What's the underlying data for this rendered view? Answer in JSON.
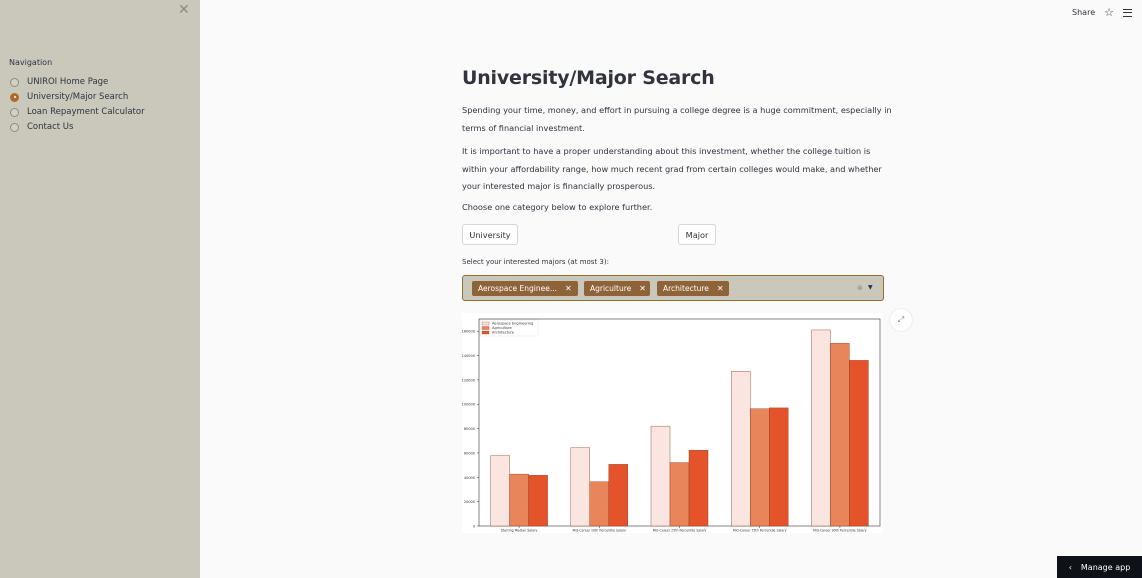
{
  "sidebar": {
    "close_icon": "close-icon",
    "nav_title": "Navigation",
    "items": [
      {
        "label": "UNIROI Home Page",
        "selected": false
      },
      {
        "label": "University/Major Search",
        "selected": true
      },
      {
        "label": "Loan Repayment Calculator",
        "selected": false
      },
      {
        "label": "Contact Us",
        "selected": false
      }
    ]
  },
  "topbar": {
    "share_label": "Share",
    "star_icon": "star-icon",
    "menu_icon": "hamburger-menu-icon"
  },
  "main": {
    "title": "University/Major Search",
    "para1": "Spending your time, money, and effort in pursuing a college degree is a huge commitment, especially in terms of financial investment.",
    "para2": "It is important to have a proper understanding about this investment, whether the college tuition is within your affordability range, how much recent grad from certain colleges would make, and whether your interested major is financially prosperous.",
    "para3": "Choose one category below to explore further.",
    "btn_university": "University",
    "btn_major": "Major",
    "multiselect_label": "Select your interested majors (at most 3):",
    "chips": [
      "Aerospace Enginee...",
      "Agriculture",
      "Architecture"
    ]
  },
  "manage_app_label": "Manage app",
  "colors": {
    "sidebar_bg": "#c9c8bb",
    "accent": "#8f633a",
    "s1": "#fbe5e1",
    "s2": "#e8855a",
    "s3": "#e5532a"
  },
  "chart_data": {
    "type": "bar",
    "categories": [
      "Starting Median Salary",
      "Mid-Career 10th Percentile Salary",
      "Mid-Career 25th Percentile Salary",
      "Mid-Career 75th Percentile Salary",
      "Mid-Career 90th Percentile Salary"
    ],
    "series": [
      {
        "name": "Aerospace Engineering",
        "color": "#fbe5e1",
        "values": [
          57700,
          64300,
          82000,
          127000,
          161000
        ]
      },
      {
        "name": "Agriculture",
        "color": "#e8855a",
        "values": [
          42600,
          36300,
          52100,
          96300,
          150000
        ]
      },
      {
        "name": "Architecture",
        "color": "#e5532a",
        "values": [
          41600,
          50600,
          62200,
          97000,
          136000
        ]
      }
    ],
    "yticks": [
      0,
      20000,
      40000,
      60000,
      80000,
      100000,
      120000,
      140000,
      160000
    ],
    "ylim": [
      0,
      170000
    ],
    "legend": "top-left",
    "grid": false
  }
}
